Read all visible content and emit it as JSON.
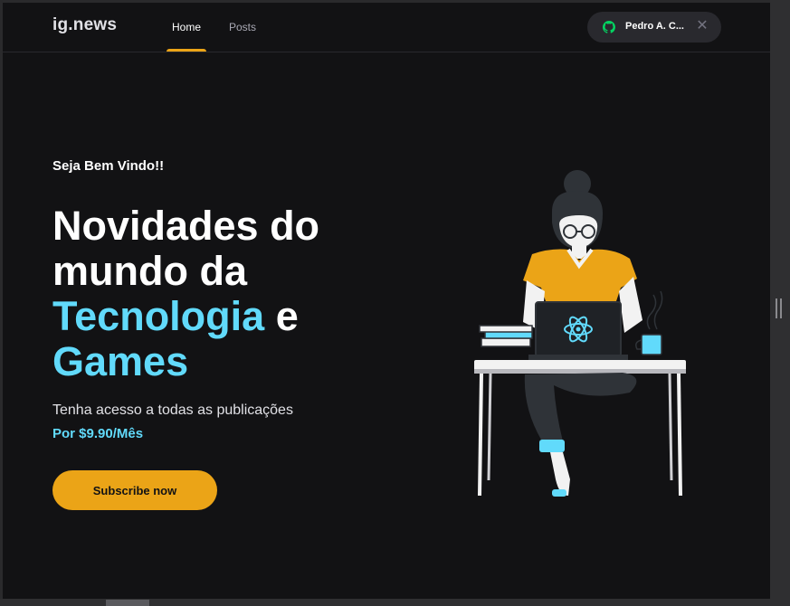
{
  "header": {
    "logo": "ig.news",
    "nav": [
      {
        "label": "Home",
        "active": true
      },
      {
        "label": "Posts",
        "active": false
      }
    ],
    "user_button": {
      "name": "Pedro A. C...",
      "icon": "github-icon",
      "close_icon": "close-icon"
    }
  },
  "hero": {
    "welcome": "Seja Bem Vindo!!",
    "headline_line1": "Novidades do",
    "headline_line2": "mundo da",
    "headline_highlight1": "Tecnologia",
    "headline_connector": "e",
    "headline_highlight2": "Games",
    "description": "Tenha acesso a todas as publicações",
    "price": "Por $9.90/Mês",
    "cta": "Subscribe now",
    "illustration": "avatar-illustration"
  },
  "colors": {
    "background": "#121214",
    "accent_yellow": "#eba417",
    "accent_cyan": "#61dafb",
    "surface": "#29292e"
  }
}
